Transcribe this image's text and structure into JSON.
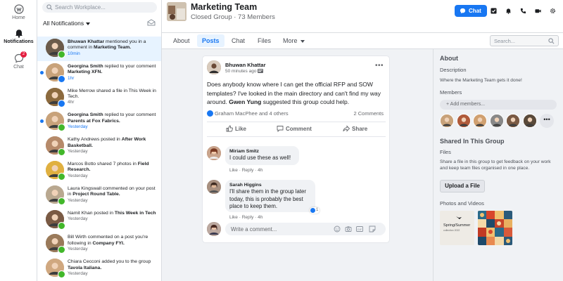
{
  "rail": {
    "items": [
      {
        "label": "Home",
        "icon": "home-icon"
      },
      {
        "label": "Notifications",
        "icon": "bell-icon"
      },
      {
        "label": "Chat",
        "icon": "chat-icon",
        "badge": "2"
      }
    ]
  },
  "notifications": {
    "search_placeholder": "Search Workplace...",
    "filter_label": "All Notifications",
    "items": [
      {
        "actor": "Bhuwan Khattar",
        "pre": " mentioned you in a comment in ",
        "target": "Marketing Team.",
        "time": "10min",
        "unread": false,
        "selected": true,
        "kind": "green",
        "avatar": "#6b5b4b"
      },
      {
        "actor": "Georgina Smith",
        "pre": " replied to your comment ",
        "target": "Marketing XFN.",
        "time": "1hr",
        "unread": true,
        "selected": false,
        "kind": "blue",
        "avatar": "#c8a27a"
      },
      {
        "actor": "",
        "pre": "Mike Merrow shared a file in This Week in Tech.",
        "target": "",
        "time": "4hr",
        "unread": false,
        "selected": false,
        "kind": "blue",
        "avatar": "#8c6a3e"
      },
      {
        "actor": "Georgina Smith",
        "pre": " replied to your comment ",
        "target": "Parents at Fox Fabrics.",
        "time": "Yesterday",
        "unread": true,
        "selected": false,
        "kind": "green",
        "avatar": "#c8a27a"
      },
      {
        "actor": "",
        "pre": "Kathy Andrews posted in ",
        "target": "After Work Basketball.",
        "time": "Yesterday",
        "unread": false,
        "selected": false,
        "kind": "green",
        "avatar": "#b68a6a"
      },
      {
        "actor": "",
        "pre": "Marcos Botto shared 7 photos in ",
        "target": "Field Research.",
        "time": "Yesterday",
        "unread": false,
        "selected": false,
        "kind": "green",
        "avatar": "#e0b040"
      },
      {
        "actor": "",
        "pre": "Laura Kingswall commented on your post in ",
        "target": "Project Round Table.",
        "time": "Yesterday",
        "unread": false,
        "selected": false,
        "kind": "green",
        "avatar": "#b9a890"
      },
      {
        "actor": "",
        "pre": "Namit Khan posted in ",
        "target": "This Week in Tech",
        "time": "Yesterday",
        "unread": false,
        "selected": false,
        "kind": "green",
        "avatar": "#7a5a44"
      },
      {
        "actor": "",
        "pre": "Bill Wirth commented on a post you're following in ",
        "target": "Company FYI.",
        "time": "Yesterday",
        "unread": false,
        "selected": false,
        "kind": "green",
        "avatar": "#9a7a5a"
      },
      {
        "actor": "",
        "pre": "Chiara Cecconi added you to the group ",
        "target": "Tavola Italiana.",
        "time": "Yesterday",
        "unread": false,
        "selected": false,
        "kind": "green",
        "avatar": "#d0a880"
      }
    ]
  },
  "header": {
    "group_name": "Marketing Team",
    "group_sub": "Closed Group · 73 Members",
    "chat_label": "Chat",
    "icons": [
      "checklist-icon",
      "bell-icon",
      "phone-icon",
      "video-icon",
      "settings-icon"
    ]
  },
  "tabs": {
    "items": [
      "About",
      "Posts",
      "Chat",
      "Files",
      "More"
    ],
    "active": "Posts",
    "search_placeholder": "Search..."
  },
  "post": {
    "author": "Bhuwan Khattar",
    "time": "50 minutes ago",
    "more": "•••",
    "body_pre": "Does anybody know where I can get the official RFP and SOW templates? I've looked in the main directory and can't find my way around. ",
    "body_bold": "Gwen Yung",
    "body_post": " suggested this group could help.",
    "likes": "Graham MacPhee and 4 others",
    "comments_count": "2 Comments",
    "actions": [
      "Like",
      "Comment",
      "Share"
    ],
    "comments": [
      {
        "name": "Miriam Smitz",
        "text": "I could use these as well!",
        "meta": "Like · Reply · 4h",
        "avatar": "#8a5a4a"
      },
      {
        "name": "Sarah Higgins",
        "text": "I'll share them in the group later today, this is probably the best place to keep them.",
        "meta": "Like · Reply · 4h",
        "avatar": "#6a5046",
        "reactions": "1"
      }
    ],
    "write_placeholder": "Write a comment..."
  },
  "about": {
    "heading": "About",
    "description_label": "Description",
    "description": "Where the Marketing Team gets it done!",
    "members_label": "Members",
    "add_members_placeholder": "+ Add members...",
    "member_colors": [
      "#c8a27a",
      "#b05a3a",
      "#d0a070",
      "#888888",
      "#7a5a44",
      "#5a4a3a"
    ],
    "more_members": "•••"
  },
  "shared": {
    "heading": "Shared In This Group",
    "files_label": "Files",
    "files_text": "Share a file in this group to get feedback on your work and keep team files organised in one place.",
    "upload_label": "Upload a  File",
    "photos_label": "Photos and Videos",
    "photo1_title": "Spring/Summer",
    "photo1_sub": "collection 2022"
  },
  "colors": {
    "accent": "#1877f2",
    "unread_dot": "#1877f2",
    "badge": "#e41e3f",
    "selected_row": "#e7f3ff"
  }
}
